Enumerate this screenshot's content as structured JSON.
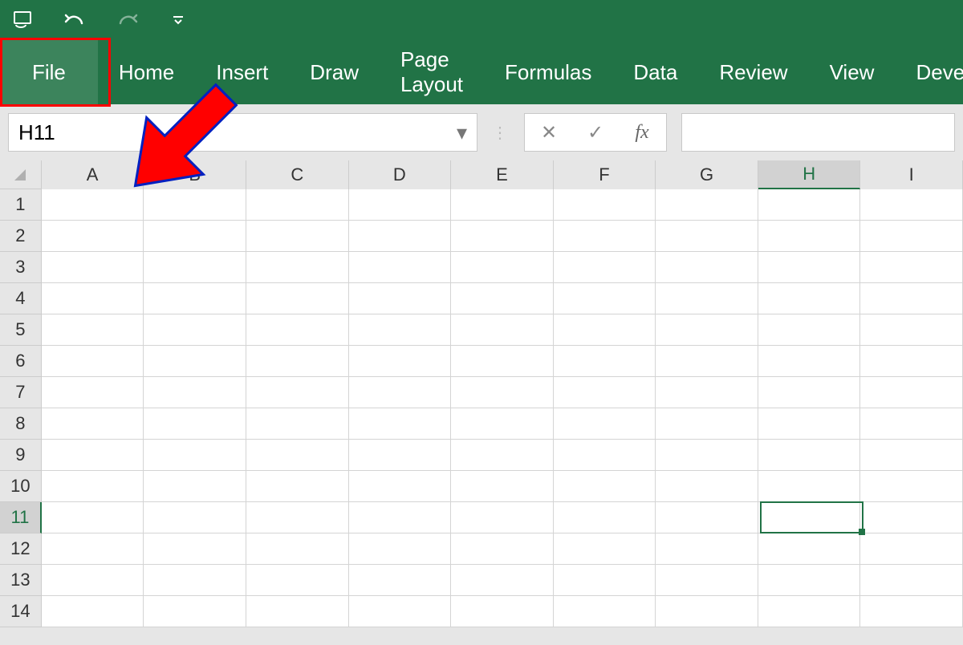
{
  "qat": {
    "save_label": "",
    "undo_label": "",
    "redo_label": "",
    "customize_label": ""
  },
  "tabs": {
    "file": "File",
    "items": [
      "Home",
      "Insert",
      "Draw",
      "Page Layout",
      "Formulas",
      "Data",
      "Review",
      "View",
      "Developer"
    ]
  },
  "namebox": {
    "value": "H11"
  },
  "fbar": {
    "cancel": "✕",
    "enter": "✓",
    "fx": "fx",
    "value": ""
  },
  "columns": [
    "A",
    "B",
    "C",
    "D",
    "E",
    "F",
    "G",
    "H",
    "I"
  ],
  "rows": [
    "1",
    "2",
    "3",
    "4",
    "5",
    "6",
    "7",
    "8",
    "9",
    "10",
    "11",
    "12",
    "13",
    "14"
  ],
  "selection": {
    "col": "H",
    "row": "11",
    "colIndex": 7,
    "rowIndex": 10
  },
  "colors": {
    "brand": "#217346",
    "highlight": "#ff0000"
  }
}
